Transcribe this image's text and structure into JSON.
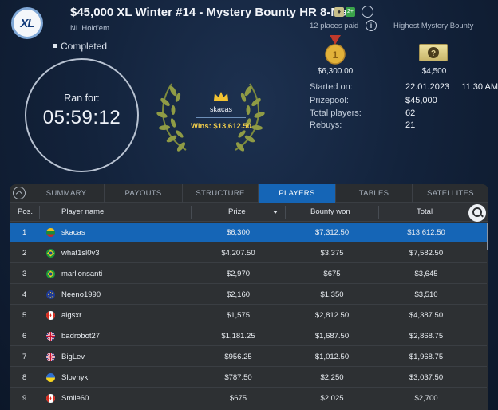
{
  "header": {
    "logo_text": "XL",
    "title": "$45,000 XL Winter #14 - Mystery Bounty HR 8-Max",
    "game_type": "NL Hold'em",
    "badge_b": "2+",
    "places_paid": "12 places paid",
    "highest_bounty_label": "Highest Mystery Bounty",
    "more_icon": "ellipsis-icon",
    "info_icon": "info-icon"
  },
  "status": "Completed",
  "clock": {
    "label": "Ran for:",
    "time": "05:59:12"
  },
  "winner": {
    "name": "skacas",
    "wins": "Wins: $13,612.50"
  },
  "prizes": {
    "first_prize": "$6,300.00",
    "mystery_bounty": "$4,500"
  },
  "info": [
    {
      "label": "Started on:",
      "value": "22.01.2023     11:30 AM"
    },
    {
      "label": "Prizepool:",
      "value": "$45,000"
    },
    {
      "label": "Total players:",
      "value": "62"
    },
    {
      "label": "Rebuys:",
      "value": "21"
    }
  ],
  "tabs": [
    "SUMMARY",
    "PAYOUTS",
    "STRUCTURE",
    "PLAYERS",
    "TABLES",
    "SATELLITES"
  ],
  "active_tab": "PLAYERS",
  "columns": [
    "Pos.",
    "Player name",
    "Prize",
    "Bounty won",
    "Total"
  ],
  "players": [
    {
      "pos": "1",
      "flag": "lithuania",
      "name": "skacas",
      "prize": "$6,300",
      "bounty": "$7,312.50",
      "total": "$13,612.50"
    },
    {
      "pos": "2",
      "flag": "brazil",
      "name": "what1sl0v3",
      "prize": "$4,207.50",
      "bounty": "$3,375",
      "total": "$7,582.50"
    },
    {
      "pos": "3",
      "flag": "brazil",
      "name": "marllonsanti",
      "prize": "$2,970",
      "bounty": "$675",
      "total": "$3,645"
    },
    {
      "pos": "4",
      "flag": "eu",
      "name": "Neeno1990",
      "prize": "$2,160",
      "bounty": "$1,350",
      "total": "$3,510"
    },
    {
      "pos": "5",
      "flag": "canada",
      "name": "algsxr",
      "prize": "$1,575",
      "bounty": "$2,812.50",
      "total": "$4,387.50"
    },
    {
      "pos": "6",
      "flag": "uk",
      "name": "badrobot27",
      "prize": "$1,181.25",
      "bounty": "$1,687.50",
      "total": "$2,868.75"
    },
    {
      "pos": "7",
      "flag": "uk",
      "name": "BigLev",
      "prize": "$956.25",
      "bounty": "$1,012.50",
      "total": "$1,968.75"
    },
    {
      "pos": "8",
      "flag": "ukraine",
      "name": "Slovnyk",
      "prize": "$787.50",
      "bounty": "$2,250",
      "total": "$3,037.50"
    },
    {
      "pos": "9",
      "flag": "canada",
      "name": "Smile60",
      "prize": "$675",
      "bounty": "$2,025",
      "total": "$2,700"
    }
  ],
  "colors": {
    "accent": "#1565b6",
    "gold": "#f1cd4b",
    "panel": "#2d3033"
  }
}
